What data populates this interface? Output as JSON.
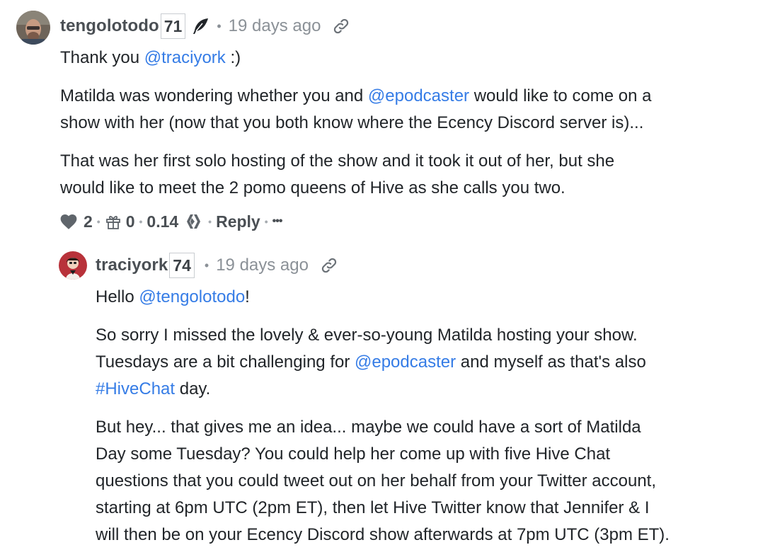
{
  "comment1": {
    "author": "tengolotodo",
    "reputation": "71",
    "time_ago": "19 days ago",
    "p1": {
      "pre": "Thank you ",
      "mention": "@traciyork",
      "post": " :)"
    },
    "p2": {
      "l1_pre": "Matilda was wondering whether you and ",
      "l1_mention": "@epodcaster",
      "l1_post": " would like to come on a",
      "l2": "show with her (now that you both know where the Ecency Discord server is)..."
    },
    "p3": {
      "l1": "That was her first solo hosting of the show and it took it out of her, but she",
      "l2": "would like to meet the 2 pomo queens of Hive as she calls you two."
    },
    "actions": {
      "votes": "2",
      "tips": "0",
      "payout": "0.14",
      "reply_label": "Reply",
      "more": "•••"
    }
  },
  "comment2": {
    "author": "traciyork",
    "reputation": "74",
    "time_ago": "19 days ago",
    "p1": {
      "pre": "Hello ",
      "mention": "@tengolotodo",
      "post": "!"
    },
    "p2": {
      "l1": "So sorry I missed the lovely & ever-so-young Matilda hosting your show.",
      "l2_pre": "Tuesdays are a bit challenging for ",
      "l2_mention": "@epodcaster",
      "l2_post": " and myself as that's also",
      "l3_tag": "#HiveChat",
      "l3_post": " day."
    },
    "p3": {
      "l1": "But hey... that gives me an idea... maybe we could have a sort of Matilda",
      "l2": "Day some Tuesday? You could help her come up with five Hive Chat",
      "l3": "questions that you could tweet out on her behalf from your Twitter account,",
      "l4": "starting at 6pm UTC (2pm ET), then let Hive Twitter know that Jennifer & I",
      "l5": "will then be on your Ecency Discord show afterwards at 7pm UTC (3pm ET)."
    }
  },
  "icons": {
    "feather": "feather-icon",
    "link": "permalink-icon",
    "heart": "heart-icon",
    "gift": "gift-icon",
    "hive": "hive-logo-icon"
  },
  "colors": {
    "link": "#357ce6",
    "text": "#212529",
    "muted": "#8b9197"
  }
}
